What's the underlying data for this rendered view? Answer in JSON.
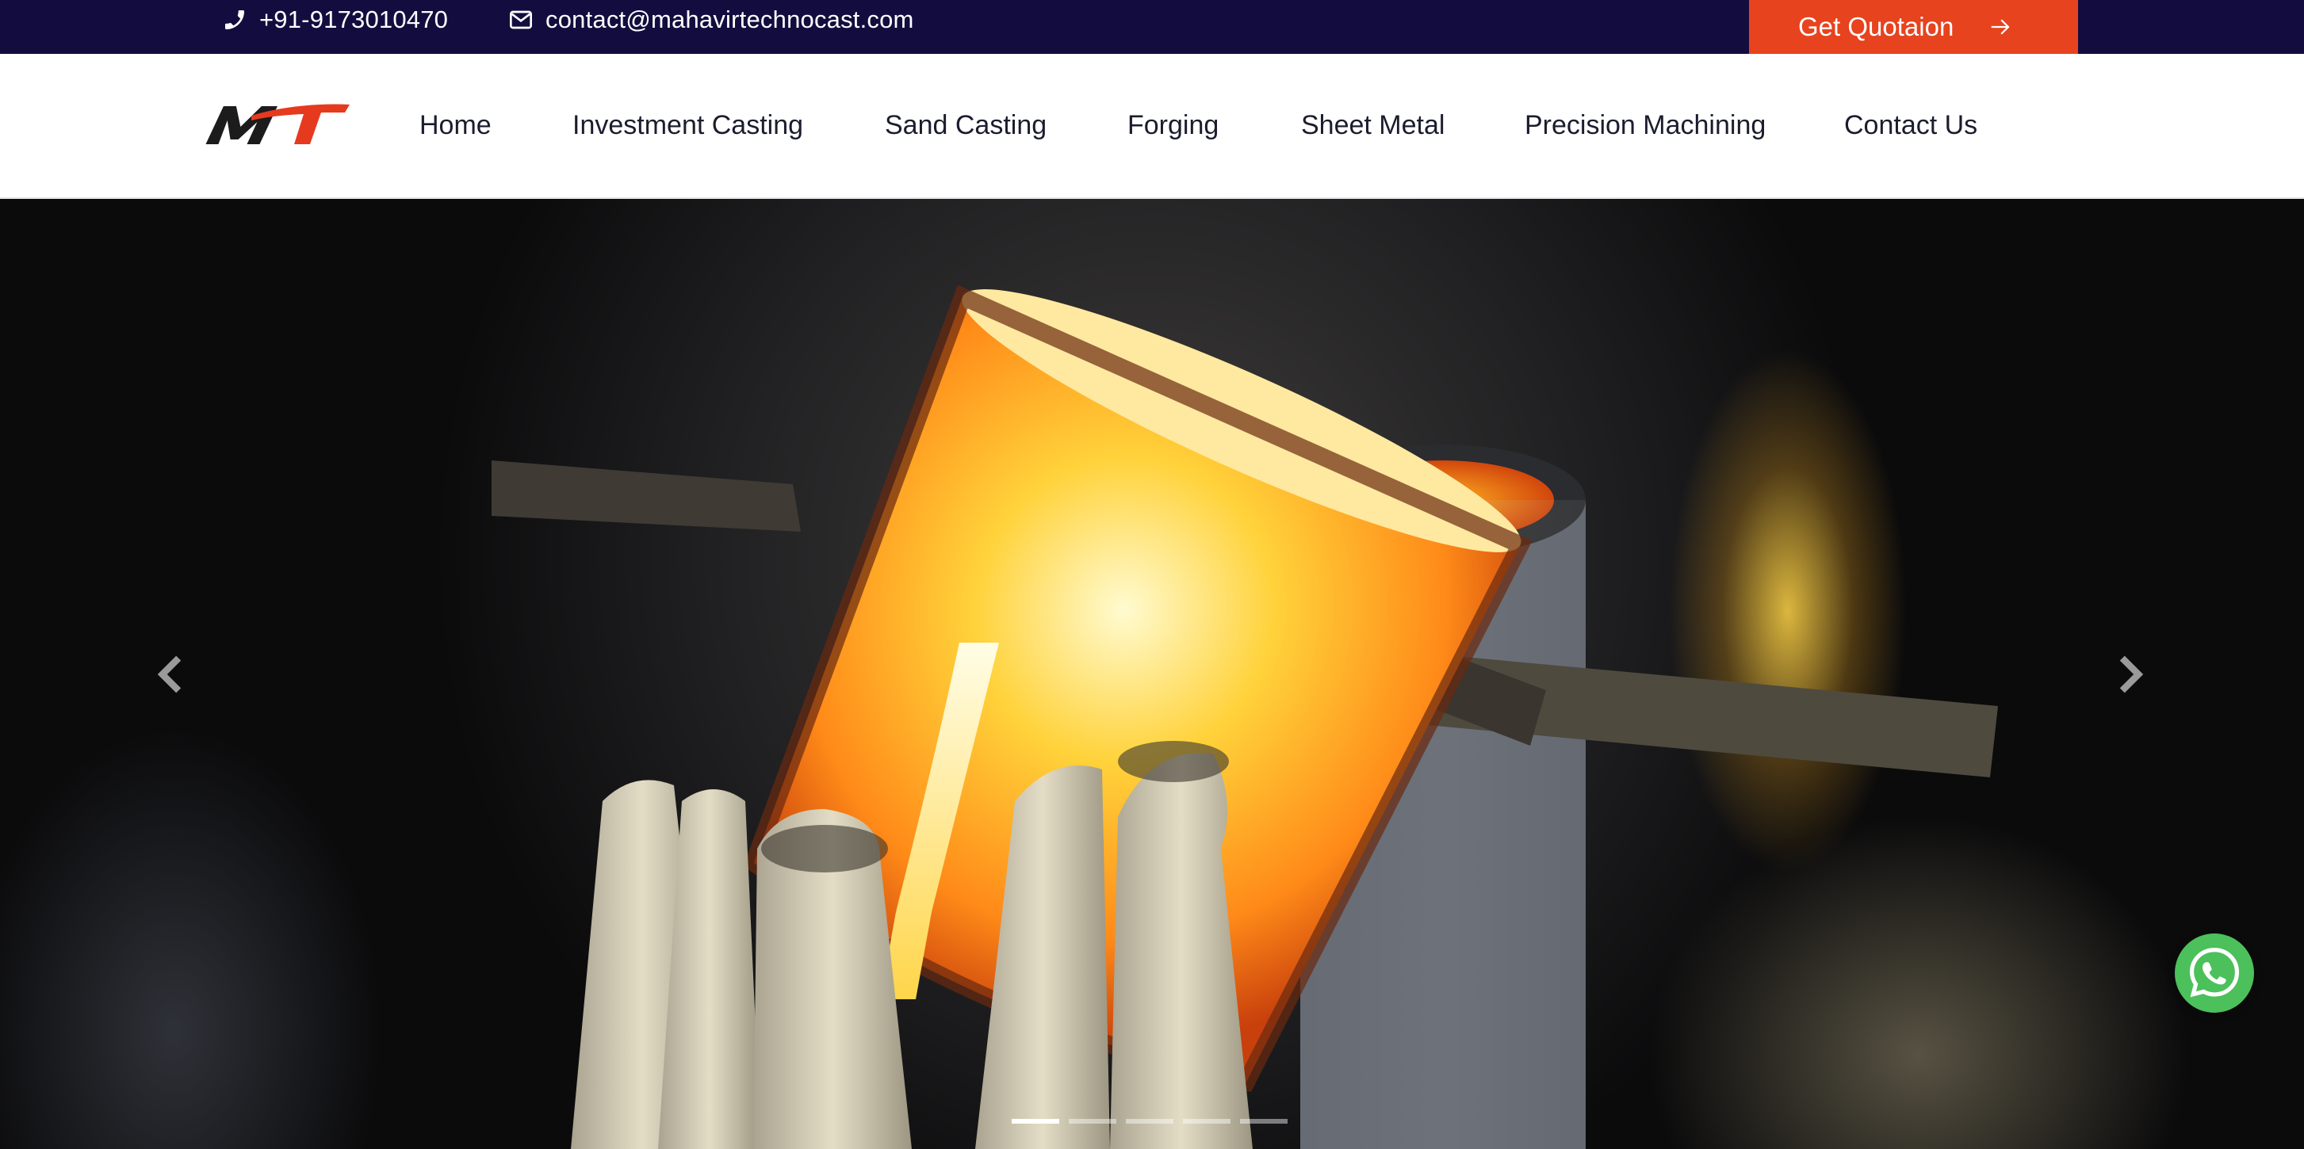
{
  "topbar": {
    "phone": "+91-9173010470",
    "email": "contact@mahavirtechnocast.com",
    "quote_label": "Get Quotaion",
    "icons": {
      "phone": "phone-icon",
      "email": "envelope-icon",
      "quote": "arrow-right-icon"
    }
  },
  "brand": {
    "logo_text": "MT",
    "colors": {
      "dark": "#1c1c1c",
      "accent": "#e63a1f"
    }
  },
  "nav": {
    "items": [
      {
        "label": "Home"
      },
      {
        "label": "Investment Casting"
      },
      {
        "label": "Sand Casting"
      },
      {
        "label": "Forging"
      },
      {
        "label": "Sheet Metal"
      },
      {
        "label": "Precision Machining"
      },
      {
        "label": "Contact Us"
      }
    ]
  },
  "hero": {
    "image": "molten-metal-pouring-into-casting-molds",
    "controls": {
      "prev": "chevron-left-icon",
      "next": "chevron-right-icon"
    },
    "slide_count": 5,
    "active_slide": 1
  },
  "whatsapp": {
    "icon": "whatsapp-icon",
    "color": "#4cc05a"
  },
  "theme": {
    "topbar_bg": "#130d3f",
    "quote_bg": "#e7431e",
    "nav_bg": "#ffffff",
    "nav_text": "#1b1d2e"
  }
}
